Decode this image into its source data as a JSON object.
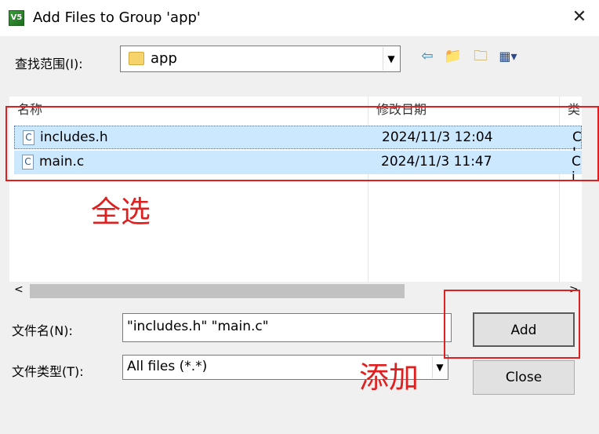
{
  "window": {
    "title": "Add Files to Group 'app'",
    "app_icon_text": "V5"
  },
  "lookin": {
    "label": "查找范围(I):",
    "value": "app"
  },
  "list": {
    "columns": [
      "名称",
      "修改日期",
      "类"
    ],
    "rows": [
      {
        "name": "includes.h",
        "date": "2024/11/3 12:04",
        "type": "C I",
        "icon": "C"
      },
      {
        "name": "main.c",
        "date": "2024/11/3 11:47",
        "type": "C i",
        "icon": "C"
      }
    ]
  },
  "filename": {
    "label": "文件名(N):",
    "value": "\"includes.h\" \"main.c\""
  },
  "filetype": {
    "label": "文件类型(T):",
    "value": "All files (*.*)"
  },
  "buttons": {
    "add": "Add",
    "close": "Close"
  },
  "annotations": {
    "select_all": "全选",
    "add": "添加",
    "color": "#e02020"
  }
}
